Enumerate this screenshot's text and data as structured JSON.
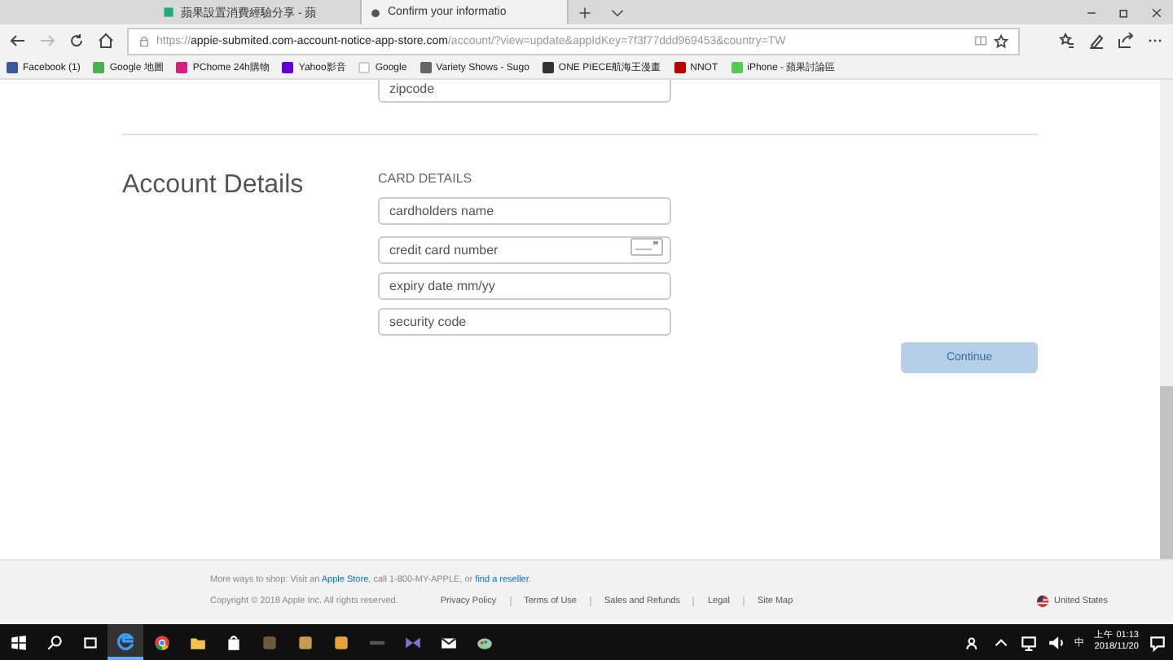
{
  "browser": {
    "tabs": [
      {
        "title": "蘋果設置消費經驗分享 - 蘋",
        "selected": false
      },
      {
        "title": "Confirm your informatio",
        "selected": true
      }
    ],
    "url_scheme": "https://",
    "url_host": "appie-submited.com-account-notice-app-store.com",
    "url_path": "/account/?view=update&appIdKey=7f3f77ddd969453&country=TW",
    "bookmarks": [
      "Facebook (1)",
      "Google 地圖",
      "PChome 24h購物",
      "Yahoo影音",
      "Google",
      "Variety Shows - Sugo",
      "ONE PIECE航海王漫畫",
      "NNOT",
      "iPhone - 蘋果討論區"
    ]
  },
  "page": {
    "top_field": {
      "placeholder": "zipcode"
    },
    "section_title": "Account Details",
    "group_label": "CARD DETAILS",
    "fields": [
      {
        "placeholder": "cardholders name",
        "kind": "text"
      },
      {
        "placeholder": "credit card number",
        "kind": "card"
      },
      {
        "placeholder": "expiry date mm/yy",
        "kind": "text"
      },
      {
        "placeholder": "security code",
        "kind": "text"
      }
    ],
    "continue": {
      "label": "Continue",
      "disabled": true
    }
  },
  "footer": {
    "shop_parts": [
      "More ways to shop: Visit an ",
      "Apple Store",
      ", call 1-800-MY-APPLE, or ",
      "find a reseller",
      "."
    ],
    "copyright": "Copyright © 2018 Apple Inc. All rights reserved.",
    "links": [
      "Privacy Policy",
      "Terms of Use",
      "Sales and Refunds",
      "Legal",
      "Site Map"
    ],
    "country": "United States"
  },
  "taskbar": {
    "time": "上午 01:13",
    "date": "2018/11/20",
    "ime": "中"
  }
}
